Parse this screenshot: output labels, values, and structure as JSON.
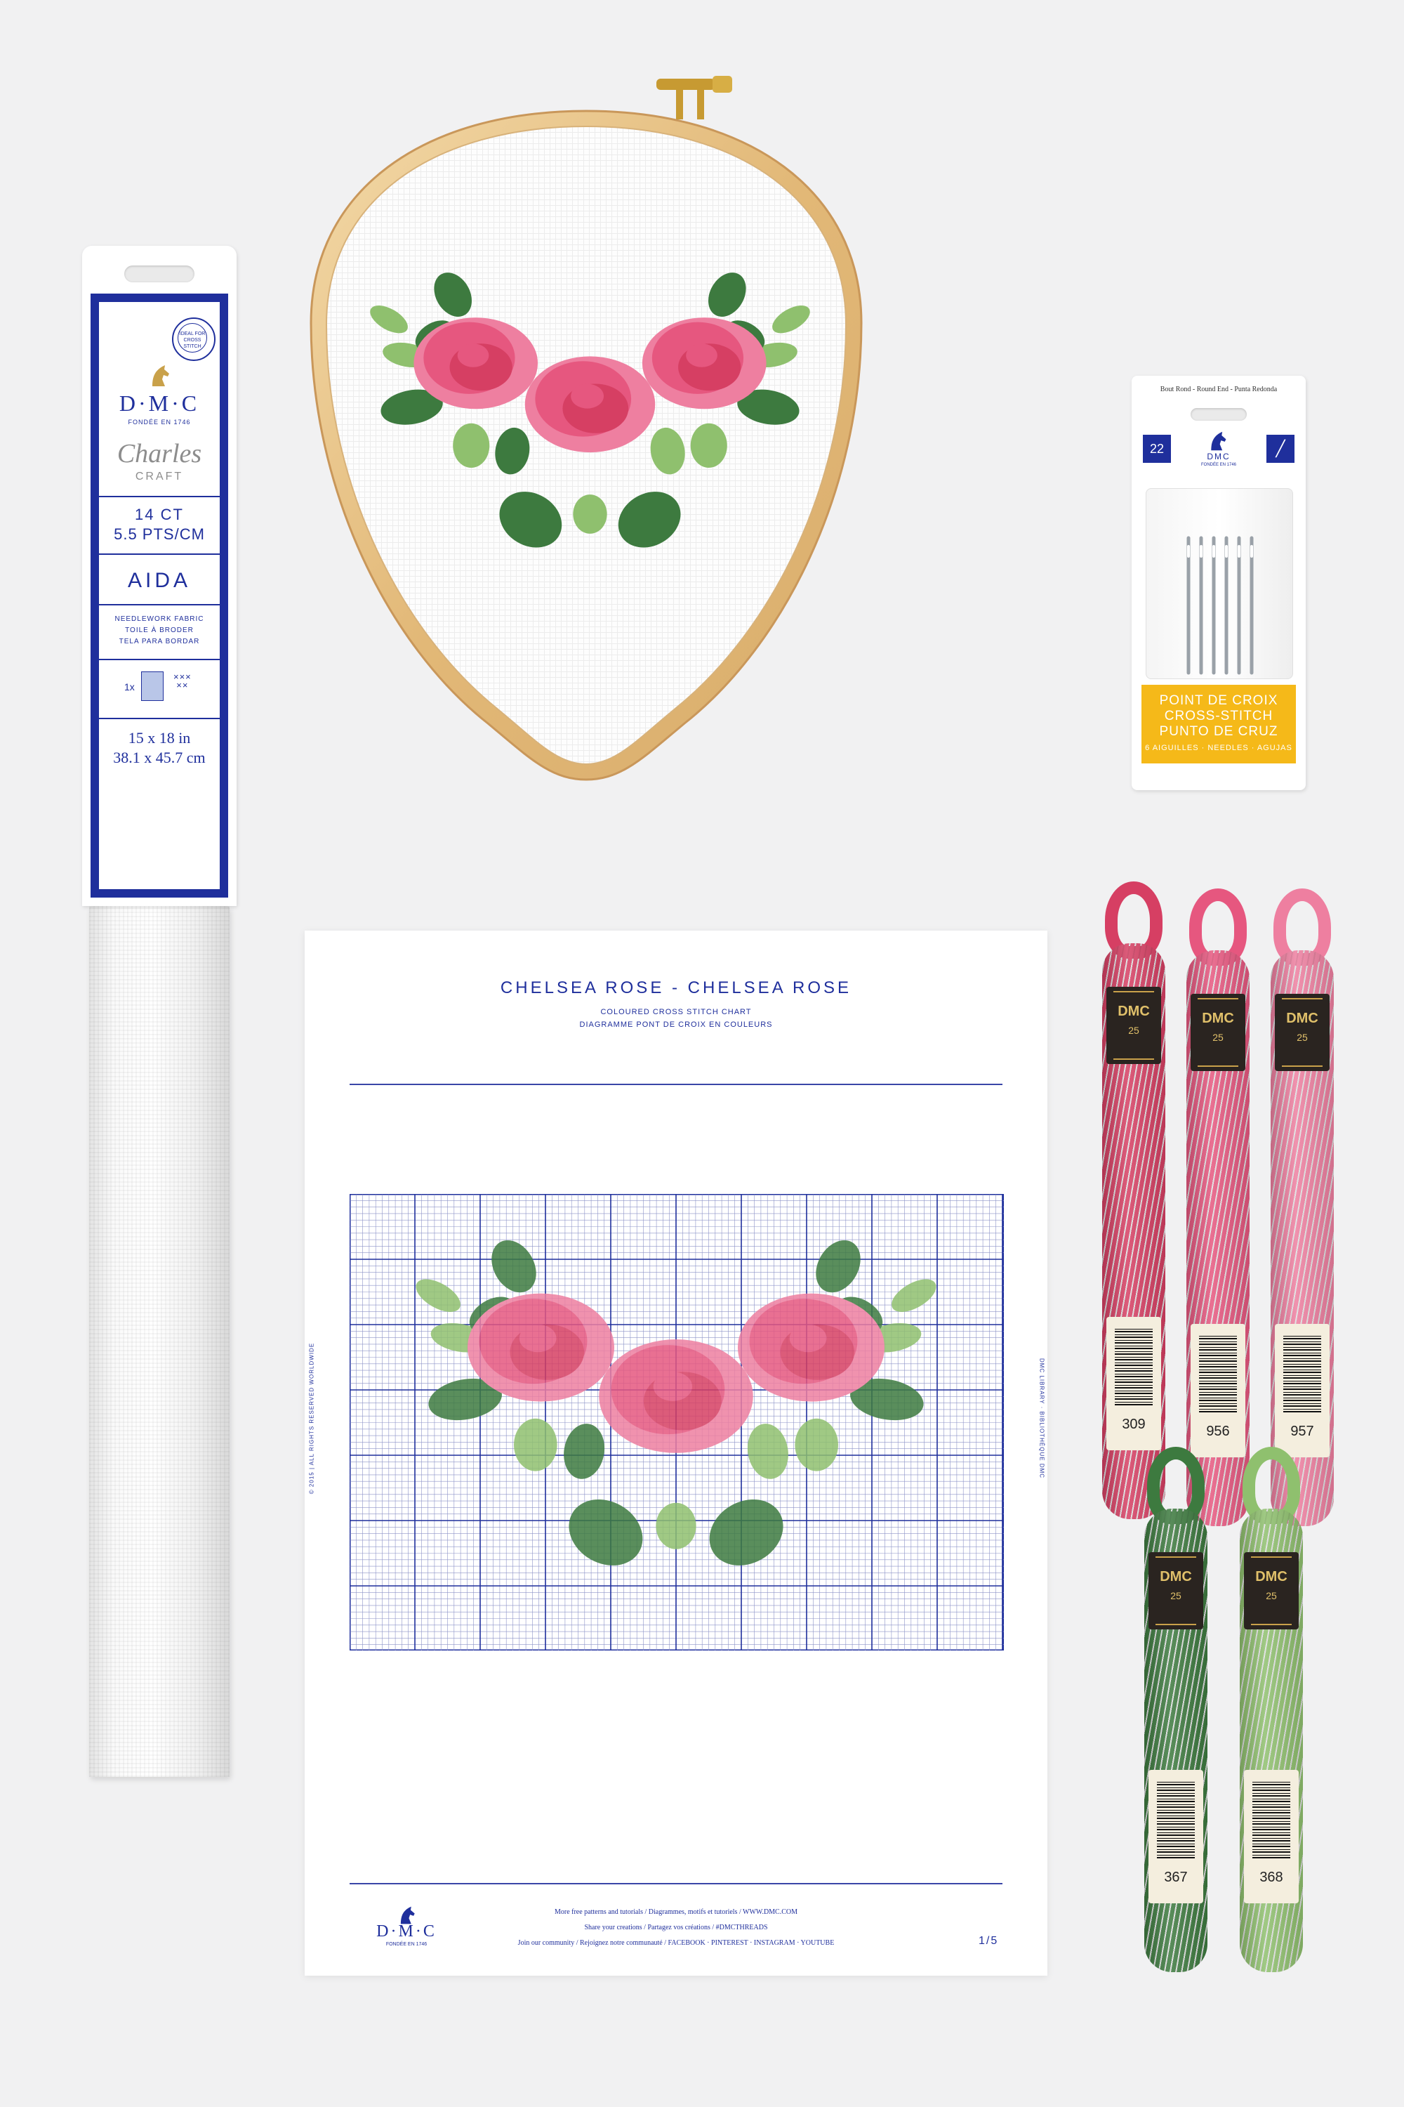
{
  "colors": {
    "dmc_blue": "#1f2f9c",
    "background": "#f1f1f2",
    "rose_dark": "#d63f63",
    "rose_mid": "#e6577f",
    "rose_light": "#ee7fa0",
    "leaf_dark": "#3d7a3f",
    "leaf_light": "#8fc06e",
    "hoop_wood": "#e6c28a",
    "needle_yellow": "#f5b919"
  },
  "aida_pack": {
    "brand": "D·M·C",
    "brand_sub": "FONDÉE EN 1746",
    "stamp": "IDEAL FOR CROSS STITCH",
    "series": "Charles",
    "series2": "CRAFT",
    "count": "14 CT",
    "count_metric": "5.5 PTS/CM",
    "fabric": "AIDA",
    "desc_en": "NEEDLEWORK FABRIC",
    "desc_fr": "TOILE À BRODER",
    "desc_es": "TELA PARA BORDAR",
    "qty": "1x",
    "size_in": "15 x 18 in",
    "size_cm": "38.1 x 45.7 cm"
  },
  "needle_pack": {
    "header": "Bout Rond - Round End - Punta Redonda",
    "size": "22",
    "brand": "DMC",
    "brand_sub": "FONDÉE EN 1746",
    "line1": "POINT DE CROIX",
    "line2": "CROSS-STITCH",
    "line3": "PUNTO DE CRUZ",
    "line4": "6 AIGUILLES · NEEDLES · AGUJAS",
    "icon": "needle-icon"
  },
  "chart_sheet": {
    "title": "CHELSEA ROSE - CHELSEA ROSE",
    "subtitle1": "COLOURED CROSS STITCH CHART",
    "subtitle2": "DIAGRAMME PONT DE CROIX EN COULEURS",
    "side_left": "© 2015 | ALL RIGHTS RESERVED WORLDWIDE",
    "side_right": "DMC LIBRARY · BIBLIOTHÈQUE DMC",
    "footer1": "More free patterns and tutorials  /  Diagrammes, motifs et tutoriels  /  WWW.DMC.COM",
    "footer2": "Share your creations  /  Partagez vos créations  /  #DMCTHREADS",
    "footer3": "Join our community  /  Rejoignez notre communauté  /  FACEBOOK · PINTEREST · INSTAGRAM · YOUTUBE",
    "brand": "D·M·C",
    "brand_sub": "FONDÉE EN 1746",
    "page": "1/5"
  },
  "threads": [
    {
      "number": "309",
      "color": "#d63f63"
    },
    {
      "number": "956",
      "color": "#e6577f"
    },
    {
      "number": "957",
      "color": "#ee7fa0"
    },
    {
      "number": "367",
      "color": "#3d7a3f"
    },
    {
      "number": "368",
      "color": "#8fc06e"
    }
  ],
  "thread_label": "DMC",
  "thread_size": "25"
}
